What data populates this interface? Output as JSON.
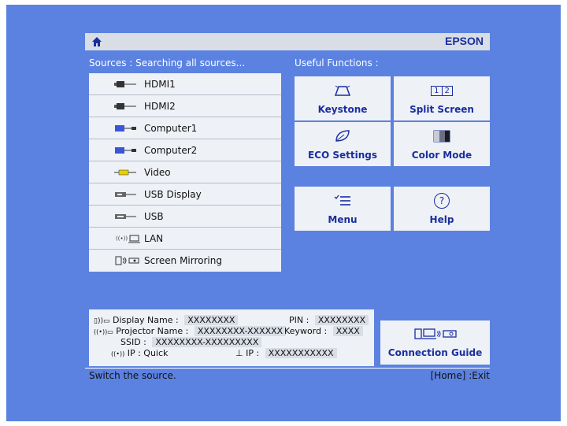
{
  "brand": "EPSON",
  "sources": {
    "heading": "Sources : Searching all sources...",
    "items": [
      {
        "label": "HDMI1",
        "icon": "hdmi-icon"
      },
      {
        "label": "HDMI2",
        "icon": "hdmi-icon"
      },
      {
        "label": "Computer1",
        "icon": "vga-icon"
      },
      {
        "label": "Computer2",
        "icon": "vga-icon"
      },
      {
        "label": "Video",
        "icon": "rca-icon"
      },
      {
        "label": "USB Display",
        "icon": "usb-display-icon"
      },
      {
        "label": "USB",
        "icon": "usb-icon"
      },
      {
        "label": "LAN",
        "icon": "lan-icon"
      },
      {
        "label": "Screen Mirroring",
        "icon": "mirroring-icon"
      }
    ]
  },
  "functions": {
    "heading": "Useful Functions :",
    "keystone": "Keystone",
    "split_screen": "Split Screen",
    "split_screen_icon_text": [
      "1",
      "2"
    ],
    "eco_settings": "ECO Settings",
    "color_mode": "Color Mode",
    "menu": "Menu",
    "help": "Help",
    "help_icon_text": "?"
  },
  "info": {
    "display_name_label": "Display Name :",
    "display_name_value": "XXXXXXXX",
    "pin_label": "PIN :",
    "pin_value": "XXXXXXXX",
    "projector_name_label": "Projector Name :",
    "projector_name_value": "XXXXXXXX-XXXXXX",
    "keyword_label": "Keyword :",
    "keyword_value": "XXXX",
    "ssid_label": "SSID :",
    "ssid_value": "XXXXXXXX-XXXXXXXXX",
    "wireless_ip_label": "IP : Quick",
    "wired_ip_label": "IP :",
    "wired_ip_value": "XXXXXXXXXXX"
  },
  "connection_guide": "Connection Guide",
  "footer": {
    "status": "Switch the source.",
    "hint": "[Home] :Exit"
  },
  "colors": {
    "background": "#5b82e0",
    "panel": "#eef1f6",
    "accent": "#1a2ea0"
  }
}
